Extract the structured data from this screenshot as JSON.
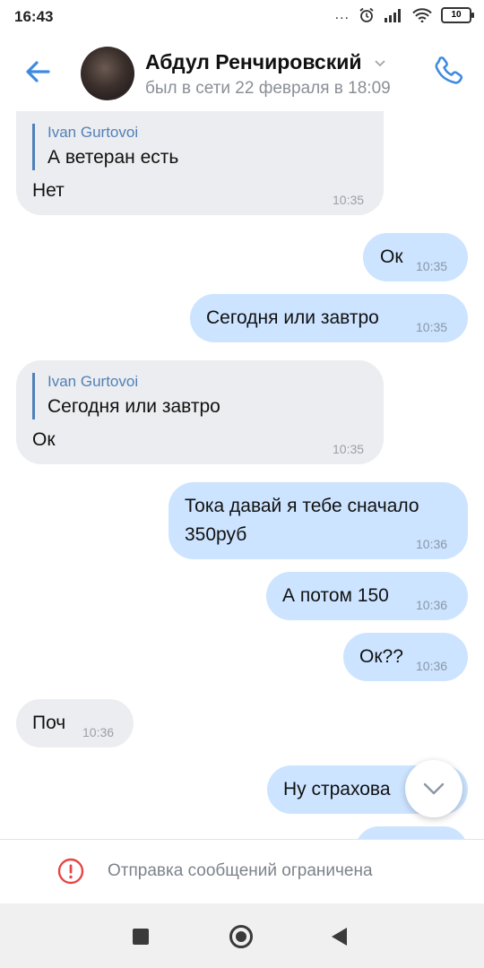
{
  "status_bar": {
    "time": "16:43",
    "battery": "10",
    "dots": "..."
  },
  "header": {
    "contact_name": "Абдул Ренчировский",
    "last_seen": "был в сети 22 февраля в 18:09"
  },
  "messages": [
    {
      "dir": "in",
      "reply_name": "Ivan Gurtovoi",
      "reply_text": "А ветеран есть",
      "text": "Нет",
      "time": "10:35"
    },
    {
      "dir": "out",
      "text": "Ок",
      "time": "10:35"
    },
    {
      "dir": "out",
      "text": "Сегодня или завтро",
      "time": "10:35"
    },
    {
      "dir": "in",
      "reply_name": "Ivan Gurtovoi",
      "reply_text": "Сегодня или завтро",
      "text": "Ок",
      "time": "10:35"
    },
    {
      "dir": "out",
      "text_line1": "Тока давай я тебе сначало",
      "text_line2": "350руб",
      "time": "10:36"
    },
    {
      "dir": "out",
      "text": "А потом 150",
      "time": "10:36"
    },
    {
      "dir": "out",
      "text": "Ок??",
      "time": "10:36"
    },
    {
      "dir": "in",
      "text": "Поч",
      "time": "10:36"
    },
    {
      "dir": "out",
      "text": "Ну страхова"
    }
  ],
  "restriction": {
    "label": "Отправка сообщений ограничена"
  },
  "colors": {
    "accent": "#5181b8",
    "incoming": "#ecedf0",
    "outgoing": "#cce4ff",
    "warning": "#e64646"
  },
  "icons": [
    "back-arrow-icon",
    "chevron-down-icon",
    "phone-icon",
    "scroll-down-icon",
    "warning-icon",
    "recents-icon",
    "home-icon",
    "back-icon"
  ]
}
